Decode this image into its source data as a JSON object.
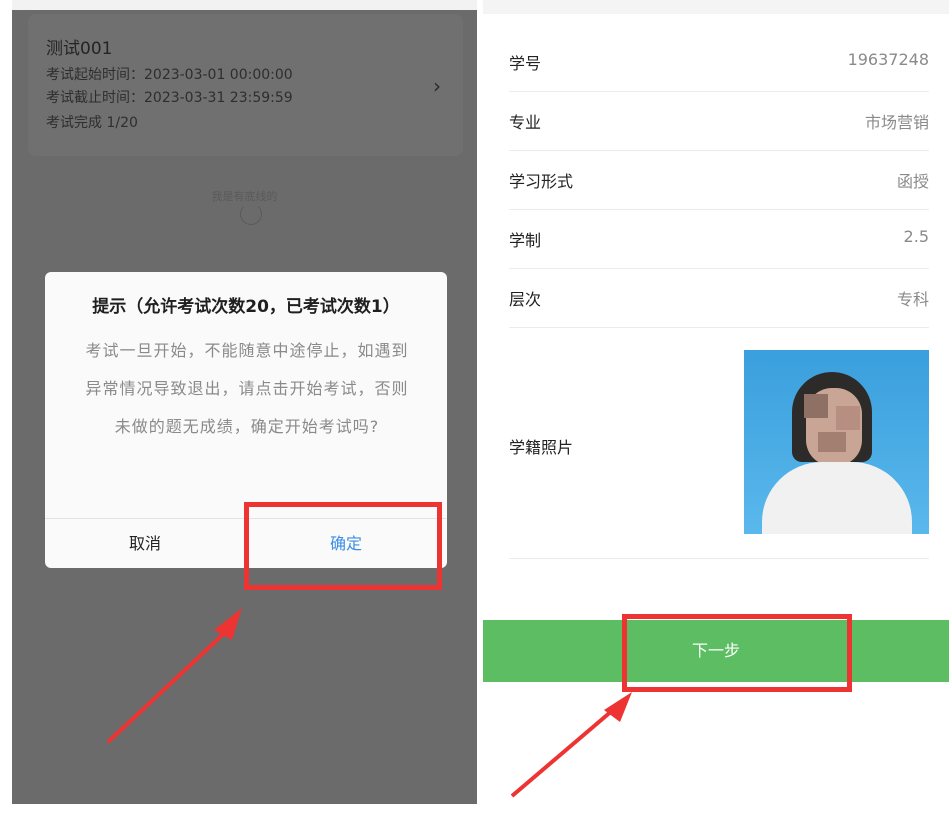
{
  "left_panel": {
    "exam_card": {
      "title": "测试001",
      "start_time": "考试起始时间：2023-03-01 00:00:00",
      "end_time": "考试截止时间：2023-03-31 23:59:59",
      "progress": "考试完成   1/20",
      "chevron_icon": "chevron-right-icon"
    },
    "bottom_text": "我是有底线的",
    "dialog": {
      "title": "提示（允许考试次数20，已考试次数1）",
      "message": "考试一旦开始，不能随意中途停止，如遇到异常情况导致退出，请点击开始考试，否则未做的题无成绩，确定开始考试吗?",
      "cancel_label": "取消",
      "confirm_label": "确定"
    }
  },
  "right_panel": {
    "rows": [
      {
        "label": "学号",
        "value": "19637248"
      },
      {
        "label": "专业",
        "value": "市场营销"
      },
      {
        "label": "学习形式",
        "value": "函授"
      },
      {
        "label": "学制",
        "value": "2.5"
      },
      {
        "label": "层次",
        "value": "专科"
      }
    ],
    "photo_label": "学籍照片",
    "next_label": "下一步"
  },
  "colors": {
    "overlay": "#6b6b6b",
    "confirm_blue": "#3a8ee6",
    "next_green": "#5cbd62",
    "annotation_red": "#ee3333"
  }
}
